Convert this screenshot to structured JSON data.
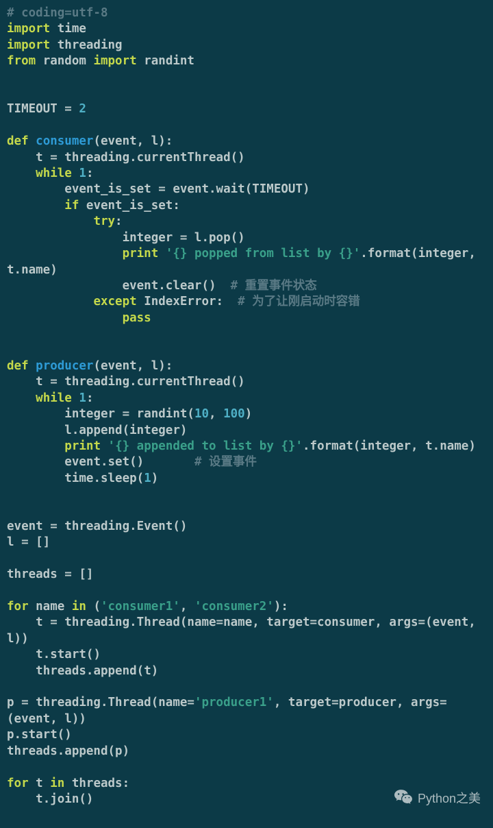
{
  "code": {
    "l1": "# coding=utf-8",
    "kw_import": "import",
    "kw_from": "from",
    "kw_def": "def",
    "kw_while": "while",
    "kw_if": "if",
    "kw_try": "try",
    "kw_except": "except",
    "kw_pass": "pass",
    "kw_for": "for",
    "kw_in": "in",
    "kw_print": "print",
    "mod_time": " time",
    "mod_threading": " threading",
    "mod_random": " random ",
    "mod_randint": " randint",
    "blank": "",
    "timeout": "TIMEOUT = ",
    "n2": "2",
    "fn_consumer": "consumer",
    "consumer_sig": "(event, l):",
    "t_assign": "    t = threading.currentThread()",
    "while_sp": " ",
    "n1": "1",
    "colon": ":",
    "eis": "        event_is_set = event.wait(TIMEOUT)",
    "if_sp": " event_is_set:",
    "try_colon": ":",
    "int_pop": "                integer = l.pop()",
    "print_sp": " ",
    "s_popped": "'{} popped from list by {}'",
    "fmt_popped": ".format(integer, t.name)",
    "evt_clear": "                event.clear()  ",
    "c_reset": "# 重置事件状态",
    "exc_sp": " IndexError:  ",
    "c_tolerate": "# 为了让刚启动时容错",
    "fn_producer": "producer",
    "producer_sig": "(event, l):",
    "int_rand": "        integer = randint(",
    "n10": "10",
    "comma_sp": ", ",
    "n100": "100",
    "rparen": ")",
    "l_append": "        l.append(integer)",
    "s_appended": "'{} appended to list by {}'",
    "fmt_appended": ".format(integer, t.name)",
    "evt_set": "        event.set()       ",
    "c_set": "# 设置事件",
    "sleep": "        time.sleep(",
    "evt_new": "event = threading.Event()",
    "l_empty": "l = []",
    "threads_empty": "threads = []",
    "for_sp": " name ",
    "in_sp": " (",
    "s_c1": "'consumer1'",
    "s_c2": "'consumer2'",
    "tuple_close": "):",
    "t_thread": "    t = threading.Thread(name=name, target=consumer, args=(event, l))",
    "t_start": "    t.start()",
    "threads_app_t": "    threads.append(t)",
    "p_thread_a": "p = threading.Thread(name=",
    "s_p1": "'producer1'",
    "p_thread_b": ", target=producer, args=(event, l))",
    "p_start": "p.start()",
    "threads_app_p": "threads.append(p)",
    "for_t": " t ",
    "in_threads": " threads:",
    "t_join": "    t.join()"
  },
  "watermark": "Python之美"
}
